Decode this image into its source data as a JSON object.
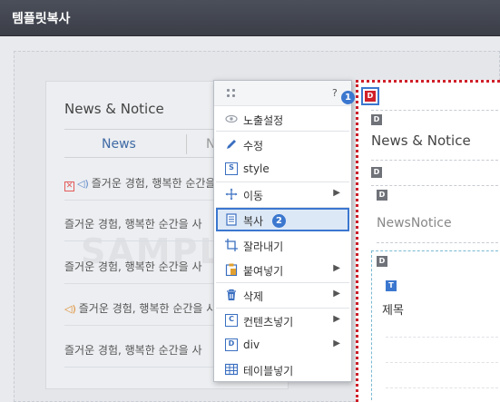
{
  "app": {
    "title": "템플릿복사"
  },
  "preview": {
    "heading": "News & Notice",
    "tabs": [
      "News",
      "N"
    ],
    "watermark": "SAMPLE",
    "items": [
      {
        "text": "즐거운 경험, 행복한 순간을 사",
        "icons": [
          "close-box",
          "speaker-blue"
        ]
      },
      {
        "text": "즐거운 경험, 행복한 순간을 사",
        "icons": []
      },
      {
        "text": "즐거운 경험, 행복한 순간을 사",
        "icons": []
      },
      {
        "text": "즐거운 경험, 행복한 순간을 사",
        "icons": [
          "speaker-orange"
        ]
      },
      {
        "text": "즐거운 경험, 행복한 순간을 사",
        "icons": []
      }
    ]
  },
  "menu": {
    "help": "?",
    "badge_top": "1",
    "badge_copy": "2",
    "items": [
      {
        "label": "노출설정",
        "icon": "eye-icon",
        "submenu": false
      },
      {
        "label": "수정",
        "icon": "pencil-icon",
        "submenu": false
      },
      {
        "label": "style",
        "icon": "style-icon",
        "submenu": false
      },
      {
        "label": "이동",
        "icon": "move-icon",
        "submenu": true
      },
      {
        "label": "복사",
        "icon": "copy-icon",
        "submenu": false,
        "selected": true
      },
      {
        "label": "잘라내기",
        "icon": "crop-icon",
        "submenu": false
      },
      {
        "label": "붙여넣기",
        "icon": "paste-icon",
        "submenu": true
      },
      {
        "label": "삭제",
        "icon": "trash-icon",
        "submenu": true
      },
      {
        "label": "컨텐츠넣기",
        "icon": "content-icon",
        "submenu": true
      },
      {
        "label": "div",
        "icon": "div-icon",
        "submenu": true
      },
      {
        "label": "테이블넣기",
        "icon": "table-icon",
        "submenu": false
      }
    ]
  },
  "panel": {
    "tag_d": "D",
    "tag_t": "T",
    "title": "News & Notice",
    "name": "NewsNotice",
    "sub": "제목"
  },
  "colors": {
    "accent": "#3b77cf",
    "selection_border": "#d0202a",
    "titlebar": "#43464f"
  }
}
